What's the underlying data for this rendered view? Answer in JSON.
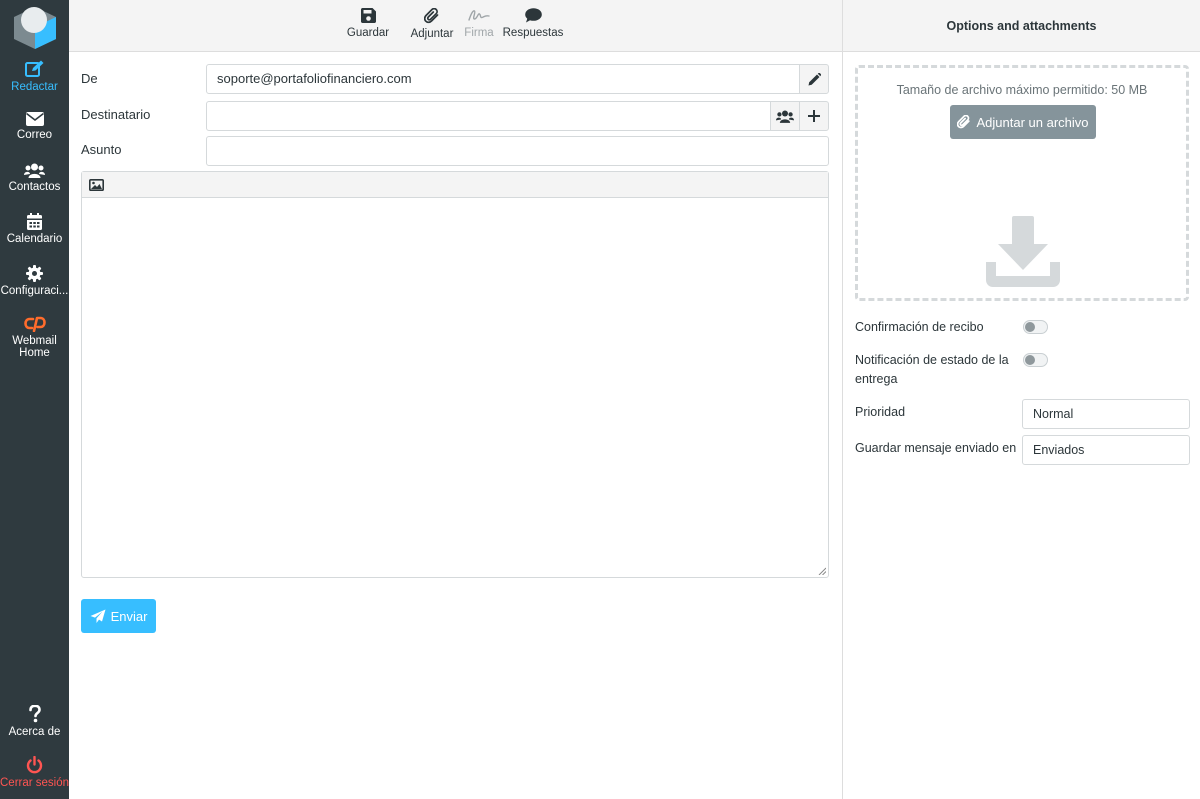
{
  "sidebar": {
    "items": [
      {
        "label": "Redactar",
        "icon": "compose-icon"
      },
      {
        "label": "Correo",
        "icon": "envelope-icon"
      },
      {
        "label": "Contactos",
        "icon": "users-icon"
      },
      {
        "label": "Calendario",
        "icon": "calendar-icon"
      },
      {
        "label": "Configuraci...",
        "icon": "gear-icon"
      },
      {
        "label": "Webmail",
        "label2": "Home",
        "icon": "cpanel-icon"
      }
    ],
    "about": "Acerca de",
    "logout": "Cerrar sesión"
  },
  "toolbar": {
    "save": "Guardar",
    "attach": "Adjuntar",
    "signature": "Firma",
    "responses": "Respuestas"
  },
  "form": {
    "from_label": "De",
    "from_value": "soporte@portafoliofinanciero.com",
    "to_label": "Destinatario",
    "to_value": "",
    "subject_label": "Asunto",
    "subject_value": ""
  },
  "send": "Enviar",
  "options": {
    "title": "Options and attachments",
    "max_size": "Tamaño de archivo máximo permitido: 50 MB",
    "attach_file": "Adjuntar un archivo",
    "receipt": "Confirmación de recibo",
    "dsn_line1": "Notificación de estado de la",
    "dsn_line2": "entrega",
    "priority_label": "Prioridad",
    "priority_value": "Normal",
    "save_sent_label": "Guardar mensaje enviado en",
    "save_sent_value": "Enviados"
  },
  "colors": {
    "sidebar": "#2f3a3f",
    "accent": "#37beff",
    "logout": "#ff5552",
    "cpanel": "#ff6c2c"
  }
}
